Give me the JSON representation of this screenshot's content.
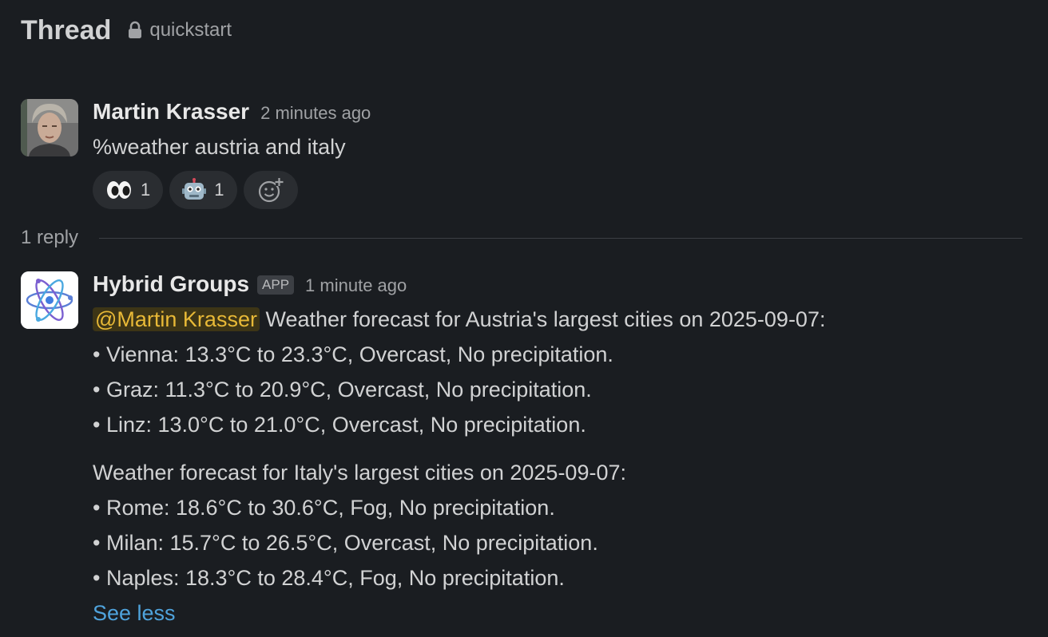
{
  "header": {
    "title": "Thread",
    "channel": "quickstart"
  },
  "original_message": {
    "sender": "Martin Krasser",
    "timestamp": "2 minutes ago",
    "text": "%weather austria and italy",
    "reactions": [
      {
        "icon": "eyes-emoji",
        "count": "1"
      },
      {
        "icon": "robot-emoji",
        "count": "1"
      }
    ]
  },
  "replies": {
    "label": "1 reply"
  },
  "reply_message": {
    "sender": "Hybrid Groups",
    "badge": "APP",
    "timestamp": "1 minute ago",
    "mention": "@Martin Krasser",
    "intro": " Weather forecast for Austria's largest cities on 2025-09-07:",
    "austria": [
      "• Vienna: 13.3°C to 23.3°C, Overcast, No precipitation.",
      "• Graz: 11.3°C to 20.9°C, Overcast, No precipitation.",
      "• Linz: 13.0°C to 21.0°C, Overcast, No precipitation."
    ],
    "italy_intro": "Weather forecast for Italy's largest cities on 2025-09-07:",
    "italy": [
      "• Rome: 18.6°C to 30.6°C, Fog, No precipitation.",
      "• Milan: 15.7°C to 26.5°C, Overcast, No precipitation.",
      "• Naples: 18.3°C to 28.4°C, Fog, No precipitation."
    ],
    "see_less": "See less"
  }
}
